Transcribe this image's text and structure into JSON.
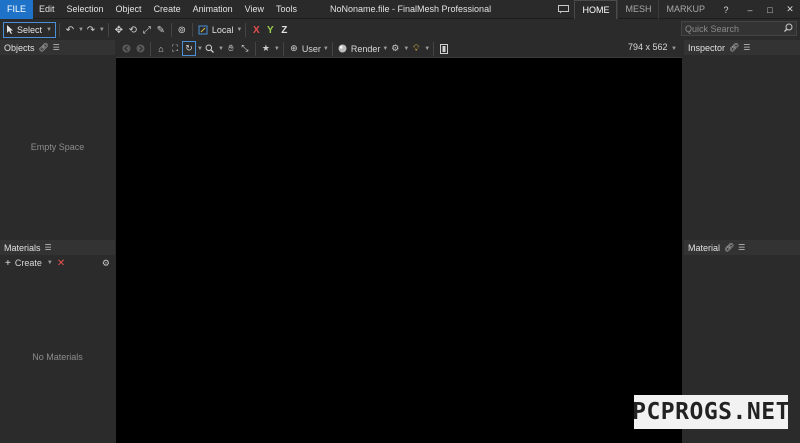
{
  "titlebar": {
    "file_label": "FILE",
    "menu": [
      "Edit",
      "Selection",
      "Object",
      "Create",
      "Animation",
      "View",
      "Tools"
    ],
    "window_title": "NoNoname.file - FinalMesh Professional",
    "mode_tabs": [
      "HOME",
      "MESH",
      "MARKUP"
    ],
    "active_tab": "HOME",
    "help_label": "?",
    "minimize_label": "–",
    "maximize_label": "□",
    "close_label": "✕"
  },
  "toolbar": {
    "select_label": "Select",
    "space_label": "Local",
    "axis_x": "X",
    "axis_y": "Y",
    "axis_z": "Z",
    "search_placeholder": "Quick Search"
  },
  "objects_panel": {
    "title": "Objects",
    "empty_text": "Empty Space"
  },
  "materials_panel": {
    "title": "Materials",
    "create_label": "Create",
    "empty_text": "No Materials"
  },
  "viewport": {
    "camera_label": "User",
    "render_label": "Render",
    "resolution": "794 x 562"
  },
  "inspector_panel": {
    "title": "Inspector"
  },
  "material_panel": {
    "title": "Material"
  },
  "watermark": "PCPROGS.NET",
  "colors": {
    "accent": "#1e73c8",
    "background": "#2b2b2b",
    "viewport": "#000000",
    "axis_x": "#e84f4f",
    "axis_y": "#9ad14b"
  }
}
